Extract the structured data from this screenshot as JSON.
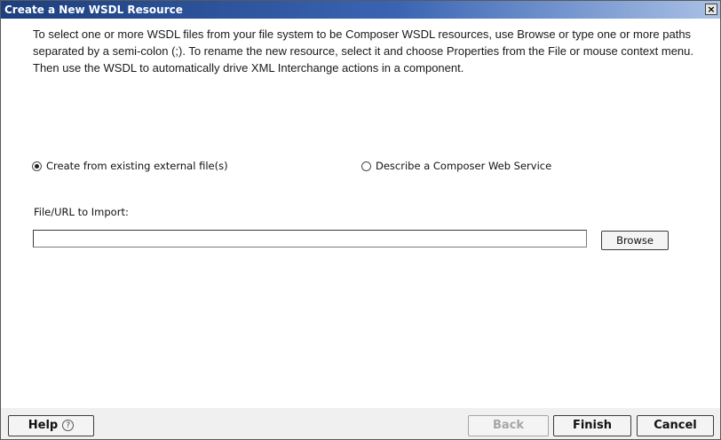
{
  "window": {
    "title": "Create a New WSDL Resource",
    "close_glyph": "×"
  },
  "description": "To select one or more WSDL files from your file system to be Composer WSDL  resources, use Browse or type one or more paths separated by a semi-colon (;).  To rename the new resource, select it and choose Properties from the File or mouse context menu. Then use the WSDL to automatically drive XML Interchange actions in a component.",
  "options": {
    "create_from_file": {
      "label": "Create from existing external file(s)",
      "selected": true
    },
    "describe_service": {
      "label": "Describe a Composer Web Service",
      "selected": false
    }
  },
  "file_import": {
    "label": "File/URL to Import:",
    "value": "",
    "browse_label": "Browse"
  },
  "footer": {
    "help_label": "Help",
    "help_icon": "question-mark-icon",
    "help_glyph": "?",
    "back_label": "Back",
    "finish_label": "Finish",
    "cancel_label": "Cancel"
  },
  "colors": {
    "title_start": "#1c3f7e",
    "title_end": "#a9c1e6",
    "disabled_text": "#a6a6a6"
  }
}
